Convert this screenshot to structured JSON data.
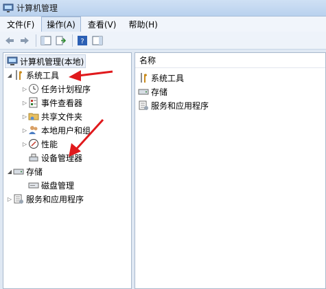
{
  "window": {
    "title": "计算机管理"
  },
  "menu": [
    {
      "label": "文件(F)"
    },
    {
      "label": "操作(A)"
    },
    {
      "label": "查看(V)"
    },
    {
      "label": "帮助(H)"
    }
  ],
  "tree": {
    "root": "计算机管理(本地)",
    "system_tools": "系统工具",
    "task_scheduler": "任务计划程序",
    "event_viewer": "事件查看器",
    "shared_folders": "共享文件夹",
    "local_users": "本地用户和组",
    "performance": "性能",
    "device_manager": "设备管理器",
    "storage": "存储",
    "disk_management": "磁盘管理",
    "services_apps": "服务和应用程序"
  },
  "right": {
    "column_header": "名称",
    "items": [
      "系统工具",
      "存储",
      "服务和应用程序"
    ]
  },
  "colors": {
    "annotation_arrow": "#e0191c",
    "title_bar": "#c4d8f1"
  }
}
